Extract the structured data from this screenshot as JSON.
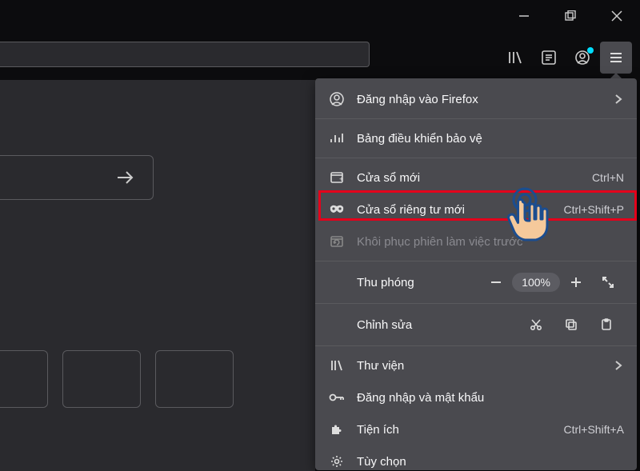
{
  "window": {
    "minimize": "—",
    "maximize": "❐",
    "close": "✕"
  },
  "toolbar": {
    "library": "library-icon",
    "reader": "reader-view-icon",
    "account": "account-icon",
    "menu": "hamburger-icon"
  },
  "menu": {
    "signin": {
      "label": "Đăng nhập vào Firefox",
      "hasSubmenu": true
    },
    "protection": {
      "label": "Bảng điều khiển bảo vệ"
    },
    "newWindow": {
      "label": "Cửa sổ mới",
      "shortcut": "Ctrl+N"
    },
    "privateWindow": {
      "label": "Cửa sổ riêng tư mới",
      "shortcut": "Ctrl+Shift+P"
    },
    "restore": {
      "label": "Khôi phục phiên làm việc trước"
    },
    "zoom": {
      "label": "Thu phóng",
      "value": "100%"
    },
    "edit": {
      "label": "Chỉnh sửa"
    },
    "library": {
      "label": "Thư viện",
      "hasSubmenu": true
    },
    "logins": {
      "label": "Đăng nhập và mật khẩu"
    },
    "addons": {
      "label": "Tiện ích",
      "shortcut": "Ctrl+Shift+A"
    },
    "options": {
      "label": "Tùy chọn"
    }
  }
}
